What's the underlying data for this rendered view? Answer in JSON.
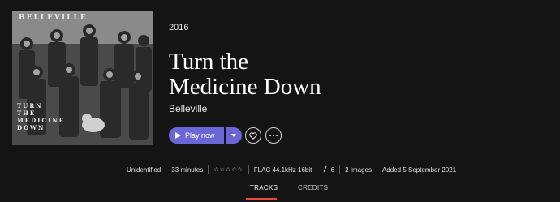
{
  "album": {
    "cover": {
      "band_text": "BELLEVILLE",
      "title_text": "TURN\nTHE\nMEDICINE\nDOWN"
    },
    "year": "2016",
    "title": "Turn the\nMedicine Down",
    "artist": "Belleville"
  },
  "actions": {
    "play_label": "Play now",
    "play_icon": "play-icon",
    "dropdown_icon": "chevron-down-icon",
    "favorite_icon": "heart-icon",
    "more_icon": "more-icon",
    "accent_color": "#6a66d6"
  },
  "meta": {
    "genre": "Unidentified",
    "duration": "33 minutes",
    "rating": "☆☆☆☆☆",
    "format": "FLAC 44.1kHz 16bit",
    "track_count": "6",
    "images": "2 Images",
    "added": "Added 5 September 2021"
  },
  "tabs": [
    {
      "label": "TRACKS",
      "active": true
    },
    {
      "label": "CREDITS",
      "active": false
    }
  ],
  "colors": {
    "background": "#141414",
    "tab_indicator": "#e64b3c"
  }
}
